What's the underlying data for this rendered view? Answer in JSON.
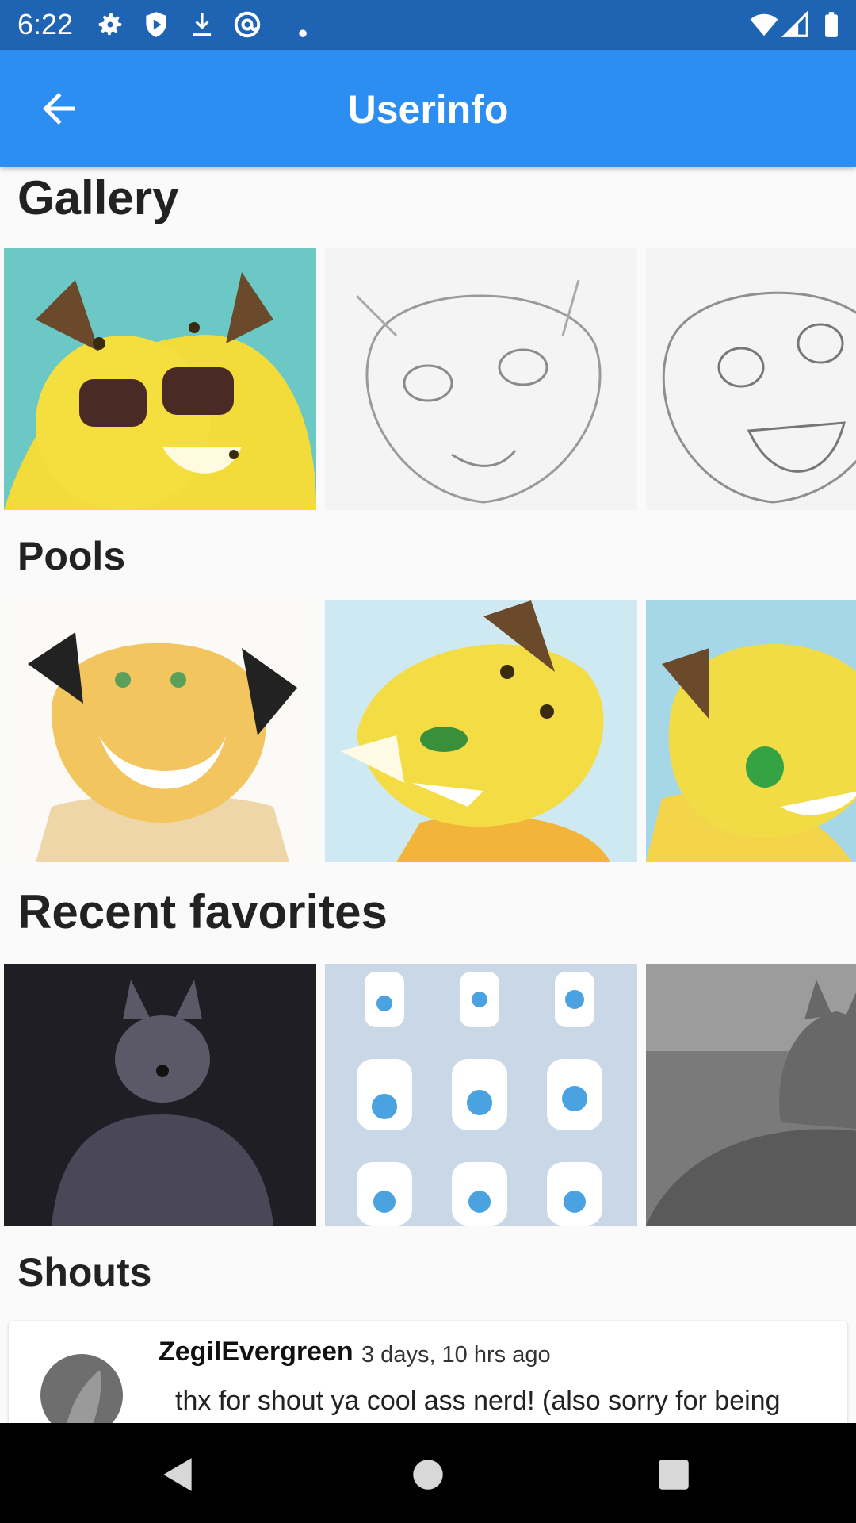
{
  "status_bar": {
    "time": "6:22",
    "icons": [
      "settings-icon",
      "shield-icon",
      "download-icon",
      "at-sign-icon",
      "dot-icon",
      "wifi-icon",
      "signal-icon",
      "battery-icon"
    ]
  },
  "app_bar": {
    "title": "Userinfo",
    "back_icon": "arrow-left-icon"
  },
  "sections": {
    "gallery": {
      "title": "Gallery"
    },
    "pools": {
      "title": "Pools"
    },
    "favorites": {
      "title": "Recent favorites"
    },
    "shouts": {
      "title": "Shouts"
    }
  },
  "shout": {
    "user": "ZegilEvergreen",
    "time": "3 days, 10 hrs ago",
    "text": "thx for shout ya cool ass nerd! (also sorry for being late, saw it)"
  },
  "nav_bar": {
    "icons": [
      "back-triangle-icon",
      "home-circle-icon",
      "recents-square-icon"
    ]
  },
  "colors": {
    "status_bar": "#1f63b3",
    "app_bar": "#2b8ef0",
    "background": "#fafafa"
  }
}
